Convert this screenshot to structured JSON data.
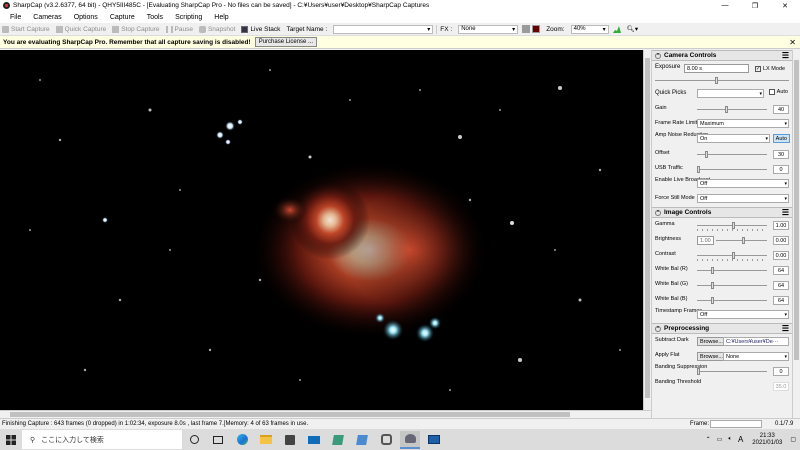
{
  "window": {
    "title": "SharpCap (v3.2.6377, 64 bit) - QHY5III485C - [Evaluating SharpCap Pro - No files can be saved] - C:¥Users¥user¥Desktop¥SharpCap Captures",
    "minimize": "—",
    "maximize": "❐",
    "close": "✕"
  },
  "menu": [
    "File",
    "Cameras",
    "Options",
    "Capture",
    "Tools",
    "Scripting",
    "Help"
  ],
  "toolbar": {
    "start_capture": "Start Capture",
    "quick_capture": "Quick Capture",
    "stop_capture": "Stop Capture",
    "pause": "Pause",
    "snapshot": "Snapshot",
    "live_stack": "Live Stack",
    "target_name_label": "Target Name :",
    "target_name_value": "",
    "fx_label": "FX :",
    "fx_value": "None",
    "zoom_label": "Zoom:",
    "zoom_value": "40%"
  },
  "warning": {
    "text": "You are evaluating SharpCap Pro. Remember that all capture saving is disabled!",
    "button": "Purchase License ...",
    "close": "✕"
  },
  "status": {
    "text": "Finishing Capture : 643 frames (0 dropped) in 1:02:34, exposure 8.0s , last frame 7.[Memory: 4 of 63 frames in use.",
    "frame_label": "Frame:",
    "frame_value": "0.1/7.9"
  },
  "camera_controls": {
    "header": "Camera Controls",
    "exposure_label": "Exposure",
    "exposure_value": "8.00 s",
    "lx_mode": "LX Mode",
    "quick_picks": "Quick Picks",
    "auto": "Auto",
    "gain_label": "Gain",
    "gain_value": "40",
    "gain_level": 0.4,
    "frame_rate_label": "Frame Rate Limit",
    "frame_rate_value": "Maximum",
    "amp_label": "Amp Noise Reduction",
    "amp_value": "On",
    "amp_auto": "Auto",
    "offset_label": "Offset",
    "offset_value": "30",
    "offset_level": 0.12,
    "usb_label": "USB Traffic",
    "usb_value": "0",
    "usb_level": 0.0,
    "live_broadcast_label": "Enable Live Broadcast",
    "live_broadcast_value": "Off",
    "force_still_label": "Force Still Mode",
    "force_still_value": "Off"
  },
  "image_controls": {
    "header": "Image Controls",
    "gamma_label": "Gamma",
    "gamma_value": "1.00",
    "gamma_level": 0.5,
    "brightness_label": "Brightness",
    "brightness_value": "0.00",
    "brightness_box": "1.00",
    "brightness_level": 0.5,
    "contrast_label": "Contrast",
    "contrast_value": "0.00",
    "contrast_level": 0.5,
    "wb_r_label": "White Bal (R)",
    "wb_r_value": "64",
    "wb_r_level": 0.2,
    "wb_g_label": "White Bal (G)",
    "wb_g_value": "64",
    "wb_g_level": 0.2,
    "wb_b_label": "White Bal (B)",
    "wb_b_value": "64",
    "wb_b_level": 0.2,
    "timestamp_label": "Timestamp Frames",
    "timestamp_value": "Off"
  },
  "preprocessing": {
    "header": "Preprocessing",
    "subtract_dark_label": "Subtract Dark",
    "subtract_dark_browse": "Browse...",
    "subtract_dark_value": "C:¥Users¥user¥De···",
    "apply_flat_label": "Apply Flat",
    "apply_flat_browse": "Browse...",
    "apply_flat_value": "None",
    "banding_supp_label": "Banding Suppression",
    "banding_supp_value": "0",
    "banding_thr_label": "Banding Threshold",
    "banding_thr_value": "35.0"
  },
  "taskbar": {
    "search_placeholder": "ここに入力して検索",
    "time": "21:33",
    "date": "2021/01/03",
    "ime": "A"
  },
  "colors": {
    "accent_red": "#cc2a1e",
    "warning_bg": "#ffffe1",
    "sky": "#000000"
  }
}
